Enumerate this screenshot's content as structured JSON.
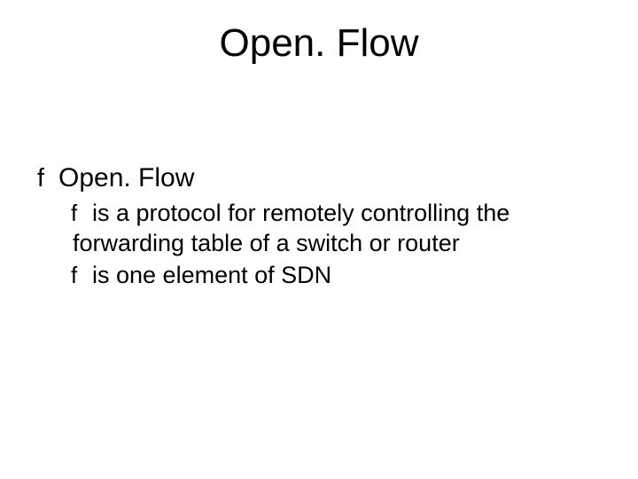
{
  "title": "Open. Flow",
  "bullet_glyph": "f",
  "items": {
    "l1": "Open. Flow",
    "sub1": "is a protocol for remotely controlling the forwarding table of a switch or router",
    "sub2": "is one element of SDN"
  }
}
